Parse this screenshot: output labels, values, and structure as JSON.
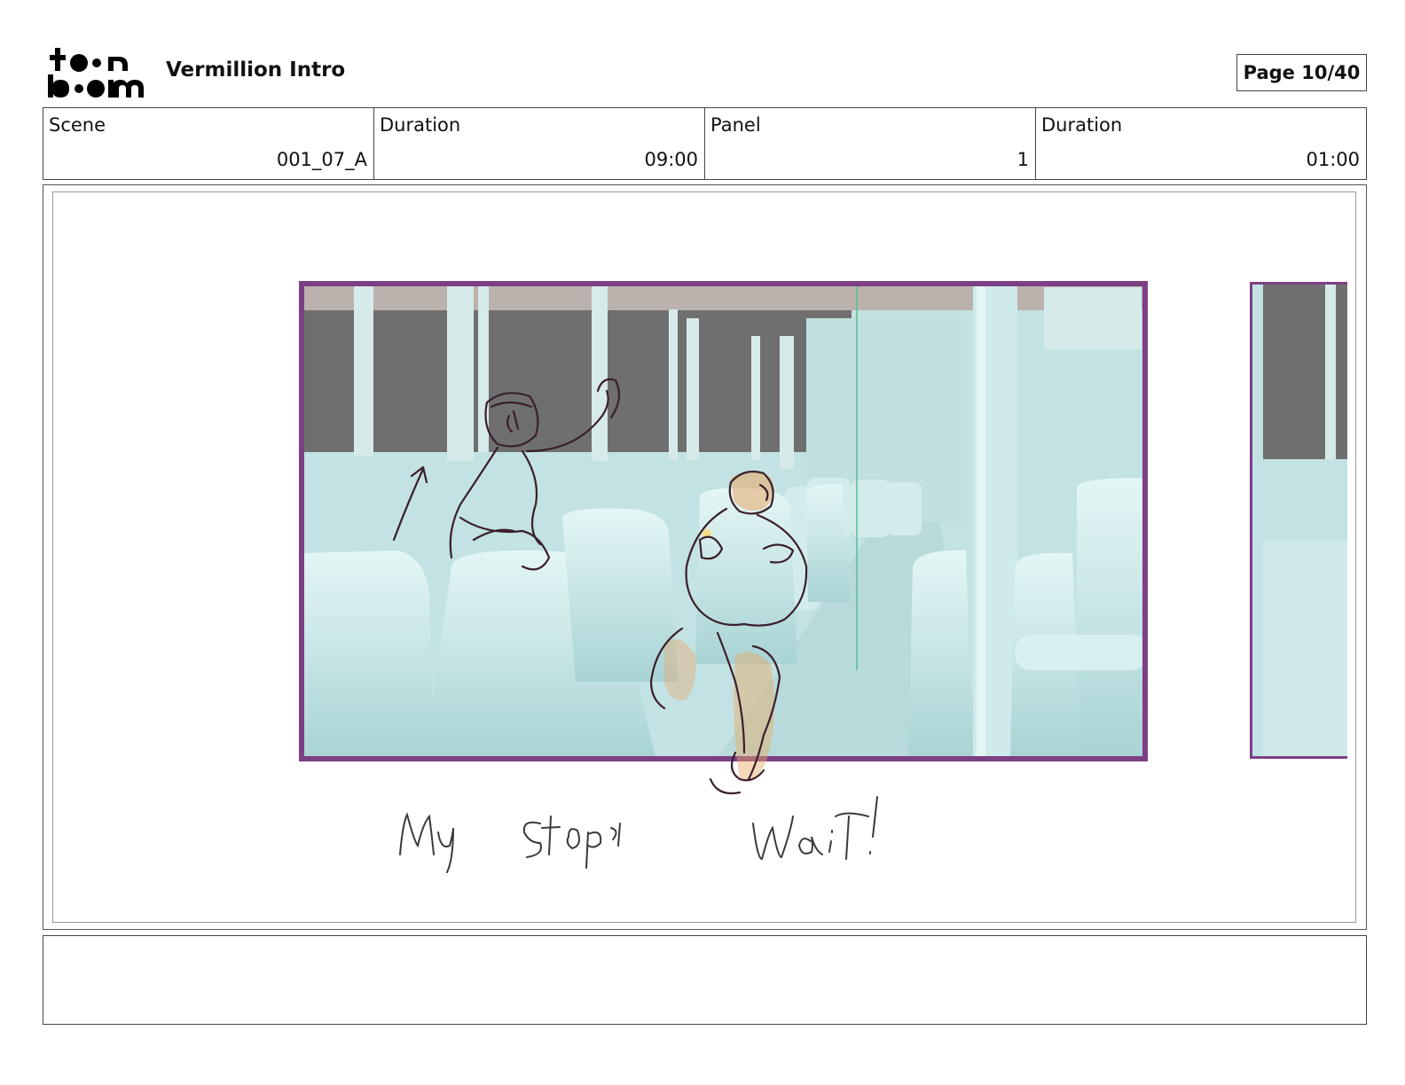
{
  "header": {
    "logo": {
      "line1": "toon",
      "line2": "boom"
    },
    "title": "Vermillion Intro",
    "page": "Page 10/40"
  },
  "info": {
    "scene_label": "Scene",
    "scene_value": "001_07_A",
    "scene_duration_label": "Duration",
    "scene_duration_value": "09:00",
    "panel_label": "Panel",
    "panel_value": "1",
    "panel_duration_label": "Duration",
    "panel_duration_value": "01:00"
  },
  "panel": {
    "handwritten_caption": "My stop!   Wait!"
  },
  "colors": {
    "camera_frame": "#7d3f86",
    "bus_interior": "#c6e6e6",
    "window": "#6f6f6f",
    "sketch_line": "#3a1f2a",
    "sketch_highlight": "#e8a866"
  },
  "notes": {
    "text": ""
  }
}
